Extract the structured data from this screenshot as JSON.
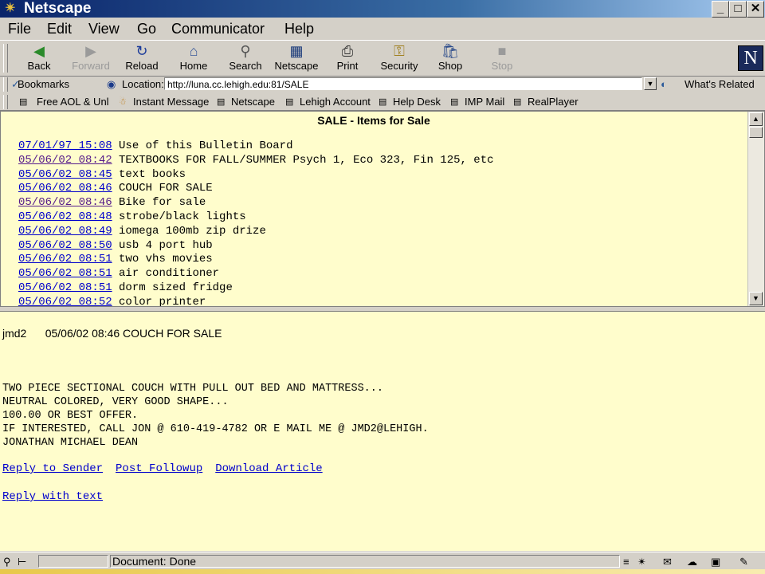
{
  "window": {
    "title": "Netscape",
    "btn_min": "_",
    "btn_max": "□",
    "btn_close": "✕"
  },
  "menu": [
    "File",
    "Edit",
    "View",
    "Go",
    "Communicator",
    "Help"
  ],
  "toolbar": {
    "back": "Back",
    "forward": "Forward",
    "reload": "Reload",
    "home": "Home",
    "search": "Search",
    "netscape": "Netscape",
    "print": "Print",
    "security": "Security",
    "shop": "Shop",
    "stop": "Stop",
    "logo": "N"
  },
  "location": {
    "bookmarks": "Bookmarks",
    "label": "Location:",
    "url": "http://luna.cc.lehigh.edu:81/SALE",
    "related": "What's Related"
  },
  "personal": [
    "Free AOL & Unl",
    "Instant Message",
    "Netscape",
    "Lehigh Account",
    "Help Desk",
    "IMP Mail",
    "RealPlayer"
  ],
  "listing": {
    "heading": "SALE - Items for Sale",
    "posts": [
      {
        "date": "07/01/97 15:08",
        "subject": "Use of this Bulletin Board",
        "visited": false
      },
      {
        "date": "05/06/02 08:42",
        "subject": "TEXTBOOKS FOR FALL/SUMMER Psych 1, Eco 323, Fin 125, etc",
        "visited": true
      },
      {
        "date": "05/06/02 08:45",
        "subject": "text books",
        "visited": false
      },
      {
        "date": "05/06/02 08:46",
        "subject": "COUCH FOR SALE",
        "visited": false
      },
      {
        "date": "05/06/02 08:46",
        "subject": "Bike for sale",
        "visited": true
      },
      {
        "date": "05/06/02 08:48",
        "subject": "strobe/black lights",
        "visited": false
      },
      {
        "date": "05/06/02 08:49",
        "subject": "iomega 100mb zip drize",
        "visited": false
      },
      {
        "date": "05/06/02 08:50",
        "subject": "usb 4 port hub",
        "visited": false
      },
      {
        "date": "05/06/02 08:51",
        "subject": "two vhs movies",
        "visited": false
      },
      {
        "date": "05/06/02 08:51",
        "subject": "air conditioner",
        "visited": false
      },
      {
        "date": "05/06/02 08:51",
        "subject": "dorm sized fridge",
        "visited": false
      },
      {
        "date": "05/06/02 08:52",
        "subject": "color printer",
        "visited": false
      }
    ]
  },
  "article": {
    "author": "jmd2",
    "header": "05/06/02 08:46 COUCH FOR SALE",
    "body": [
      "TWO PIECE SECTIONAL COUCH WITH PULL OUT BED AND MATTRESS...",
      "NEUTRAL COLORED, VERY GOOD SHAPE...",
      "100.00 OR BEST OFFER.",
      "IF INTERESTED, CALL JON @ 610-419-4782 OR E MAIL ME @ JMD2@LEHIGH.",
      "JONATHAN MICHAEL DEAN"
    ],
    "reply_sender": "Reply to Sender",
    "post_followup": "Post Followup",
    "download": "Download Article",
    "reply_text": "Reply with text"
  },
  "status": {
    "message": "Document: Done"
  }
}
